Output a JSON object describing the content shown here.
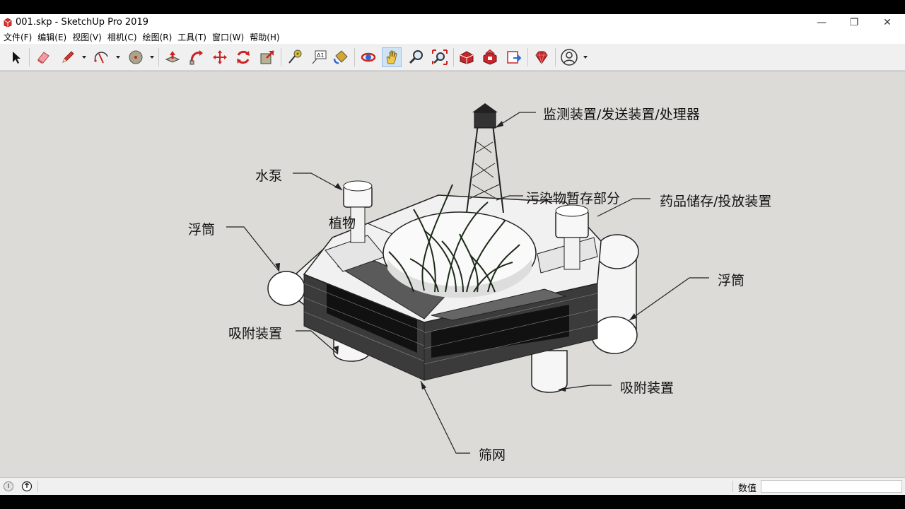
{
  "window": {
    "title": "001.skp - SketchUp Pro 2019",
    "controls": {
      "minimize": "—",
      "restore": "❐",
      "close": "✕"
    }
  },
  "menu": [
    "文件(F)",
    "编辑(E)",
    "视图(V)",
    "相机(C)",
    "绘图(R)",
    "工具(T)",
    "窗口(W)",
    "帮助(H)"
  ],
  "toolbar": {
    "tools": [
      "select-icon",
      "eraser-icon",
      "pencil-icon",
      "arc-icon",
      "shape-icon",
      "push-pull-icon",
      "follow-me-icon",
      "move-icon",
      "rotate-icon",
      "scale-icon",
      "tape-measure-icon",
      "text-icon",
      "paint-bucket-icon",
      "orbit-icon",
      "pan-icon",
      "zoom-icon",
      "zoom-extents-icon",
      "warehouse-icon",
      "extension-warehouse-icon",
      "send-to-layout-icon",
      "ruby-icon",
      "account-icon"
    ],
    "active": "pan-icon"
  },
  "annotations": {
    "monitor": "监测装置/发送装置/处理器",
    "pump": "水泵",
    "pollutant": "污染物暂存部分",
    "chemical": "药品储存/投放装置",
    "float_left": "浮筒",
    "plant": "植物",
    "float_right": "浮筒",
    "adsorb_left": "吸附装置",
    "adsorb_right": "吸附装置",
    "screen": "筛网"
  },
  "status": {
    "measurements_label": "数值",
    "measurements_value": ""
  },
  "colors": {
    "viewport_bg": "#dcdbd7",
    "toolbar_bg": "#f0f0f0",
    "active_tool": "#cfe3f5"
  }
}
